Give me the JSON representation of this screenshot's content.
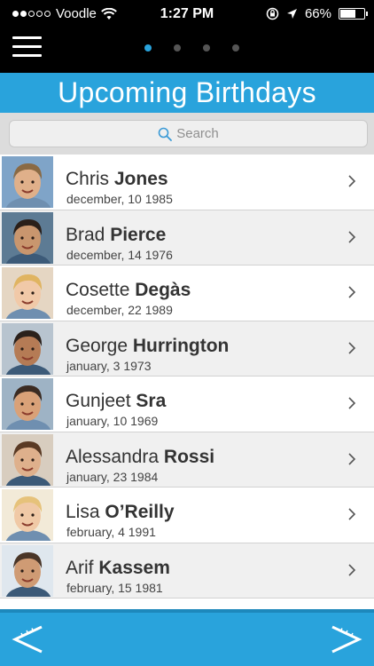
{
  "status": {
    "carrier": "Voodle",
    "time": "1:27 PM",
    "battery": "66%",
    "battery_level": 0.66
  },
  "nav": {
    "page_count": 4,
    "active_page": 1
  },
  "title": "Upcoming Birthdays",
  "search": {
    "placeholder": "Search"
  },
  "contacts": [
    {
      "first": "Chris",
      "last": "Jones",
      "date": "december, 10 1985"
    },
    {
      "first": "Brad",
      "last": "Pierce",
      "date": "december, 14 1976"
    },
    {
      "first": "Cosette",
      "last": "Degàs",
      "date": "december, 22 1989"
    },
    {
      "first": "George",
      "last": "Hurrington",
      "date": "january, 3 1973"
    },
    {
      "first": "Gunjeet",
      "last": "Sra",
      "date": "january, 10 1969"
    },
    {
      "first": "Alessandra",
      "last": "Rossi",
      "date": "january, 23 1984"
    },
    {
      "first": "Lisa",
      "last": "O’Reilly",
      "date": "february, 4 1991"
    },
    {
      "first": "Arif",
      "last": "Kassem",
      "date": "february, 15 1981"
    }
  ],
  "colors": {
    "accent": "#29a3dc",
    "bar": "#000000",
    "row_alt": "#f0f0f0"
  },
  "icons": {
    "menu": "hamburger-icon",
    "search": "search-icon",
    "row_chevron": "chevron-right-icon",
    "prev": "chevron-left-arrow-icon",
    "next": "chevron-right-arrow-icon"
  }
}
